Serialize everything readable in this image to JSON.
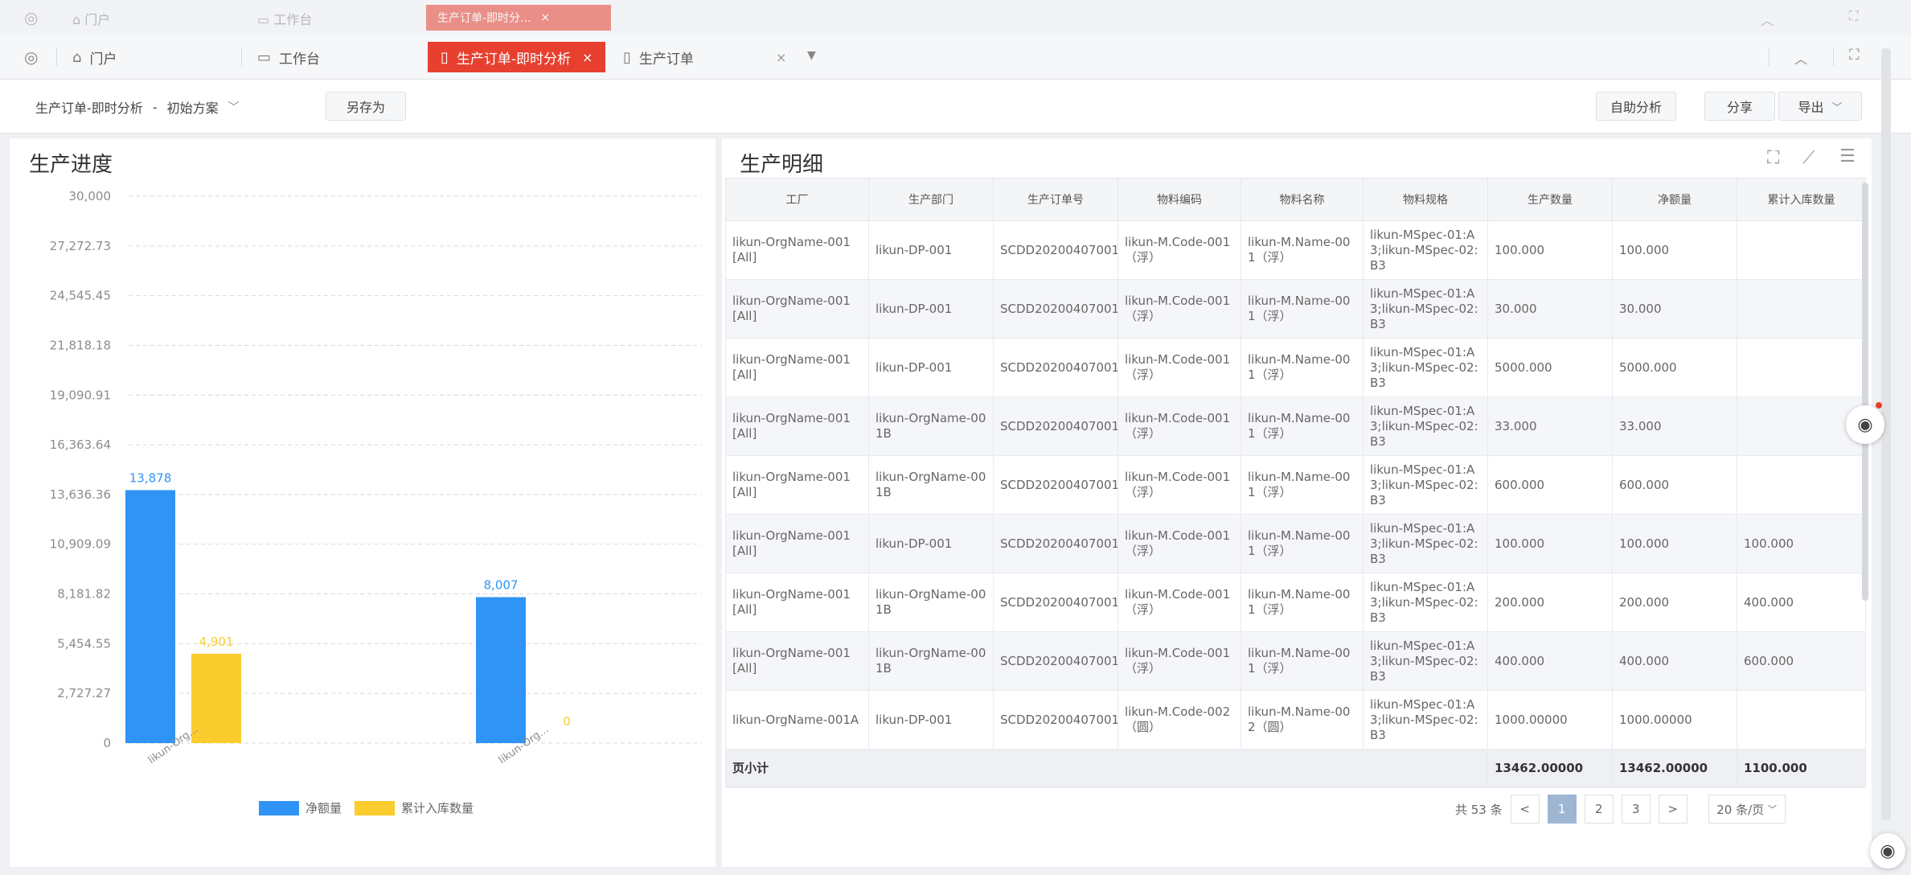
{
  "ghost_tabs": {
    "home": "门户",
    "workbench": "工作台",
    "active": "生产订单-即时分..."
  },
  "tabs": [
    {
      "label": "门户",
      "icon": "home-icon"
    },
    {
      "label": "工作台",
      "icon": "monitor-icon"
    },
    {
      "label": "生产订单-即时分析",
      "icon": "document-icon",
      "active": true
    },
    {
      "label": "生产订单",
      "icon": "document-icon"
    }
  ],
  "toolbar": {
    "report_name": "生产订单-即时分析",
    "separator": "-",
    "scheme": "初始方案",
    "save_as": "另存为",
    "auto_analysis": "自助分析",
    "share": "分享",
    "export": "导出"
  },
  "progress_panel": {
    "title": "生产进度"
  },
  "chart_data": {
    "type": "bar",
    "title": "生产进度",
    "categories": [
      "likun-Org...",
      "likun-Org..."
    ],
    "series": [
      {
        "name": "净额量",
        "color": "#2f94f5",
        "values": [
          13878,
          8007
        ]
      },
      {
        "name": "累计入库数量",
        "color": "#fbcc2e",
        "values": [
          4901,
          0
        ]
      }
    ],
    "data_labels": [
      [
        "13,878",
        "4,901"
      ],
      [
        "8,007",
        "0"
      ]
    ],
    "ylim": [
      0,
      30000
    ],
    "yticks": [
      "0",
      "2,727.27",
      "5,454.55",
      "8,181.82",
      "10,909.09",
      "13,636.36",
      "16,363.64",
      "19,090.91",
      "21,818.18",
      "24,545.45",
      "27,272.73",
      "30,000"
    ],
    "grid": true,
    "legend": "bottom-center"
  },
  "detail_panel": {
    "title": "生产明细",
    "columns": [
      "工厂",
      "生产部门",
      "生产订单号",
      "物料编码",
      "物料名称",
      "物料规格",
      "生产数量",
      "净额量",
      "累计入库数量"
    ],
    "rows": [
      [
        "likun-OrgName-001[All]",
        "likun-DP-001",
        "SCDD20200407001",
        "likun-M.Code-001（浮）",
        "likun-M.Name-001（浮）",
        "likun-MSpec-01:A3;likun-MSpec-02:B3",
        "100.000",
        "100.000",
        ""
      ],
      [
        "likun-OrgName-001[All]",
        "likun-DP-001",
        "SCDD20200407001",
        "likun-M.Code-001（浮）",
        "likun-M.Name-001（浮）",
        "likun-MSpec-01:A3;likun-MSpec-02:B3",
        "30.000",
        "30.000",
        ""
      ],
      [
        "likun-OrgName-001[All]",
        "likun-DP-001",
        "SCDD20200407001",
        "likun-M.Code-001（浮）",
        "likun-M.Name-001（浮）",
        "likun-MSpec-01:A3;likun-MSpec-02:B3",
        "5000.000",
        "5000.000",
        ""
      ],
      [
        "likun-OrgName-001[All]",
        "likun-OrgName-001B",
        "SCDD20200407001",
        "likun-M.Code-001（浮）",
        "likun-M.Name-001（浮）",
        "likun-MSpec-01:A3;likun-MSpec-02:B3",
        "33.000",
        "33.000",
        ""
      ],
      [
        "likun-OrgName-001[All]",
        "likun-OrgName-001B",
        "SCDD20200407001",
        "likun-M.Code-001（浮）",
        "likun-M.Name-001（浮）",
        "likun-MSpec-01:A3;likun-MSpec-02:B3",
        "600.000",
        "600.000",
        ""
      ],
      [
        "likun-OrgName-001[All]",
        "likun-DP-001",
        "SCDD20200407001",
        "likun-M.Code-001（浮）",
        "likun-M.Name-001（浮）",
        "likun-MSpec-01:A3;likun-MSpec-02:B3",
        "100.000",
        "100.000",
        "100.000"
      ],
      [
        "likun-OrgName-001[All]",
        "likun-OrgName-001B",
        "SCDD20200407001",
        "likun-M.Code-001（浮）",
        "likun-M.Name-001（浮）",
        "likun-MSpec-01:A3;likun-MSpec-02:B3",
        "200.000",
        "200.000",
        "400.000"
      ],
      [
        "likun-OrgName-001[All]",
        "likun-OrgName-001B",
        "SCDD20200407001",
        "likun-M.Code-001（浮）",
        "likun-M.Name-001（浮）",
        "likun-MSpec-01:A3;likun-MSpec-02:B3",
        "400.000",
        "400.000",
        "600.000"
      ],
      [
        "likun-OrgName-001A",
        "likun-DP-001",
        "SCDD20200407001",
        "likun-M.Code-002（圆）",
        "likun-M.Name-002（圆）",
        "likun-MSpec-01:A3;likun-MSpec-02:B3",
        "1000.00000",
        "1000.00000",
        ""
      ]
    ],
    "total": {
      "label": "页小计",
      "qty": "13462.00000",
      "net": "13462.00000",
      "stock": "1100.000"
    }
  },
  "pager": {
    "total": "共 53 条",
    "pages": [
      "1",
      "2",
      "3"
    ],
    "current": "1",
    "prev": "<",
    "next": ">",
    "page_size": "20 条/页"
  }
}
